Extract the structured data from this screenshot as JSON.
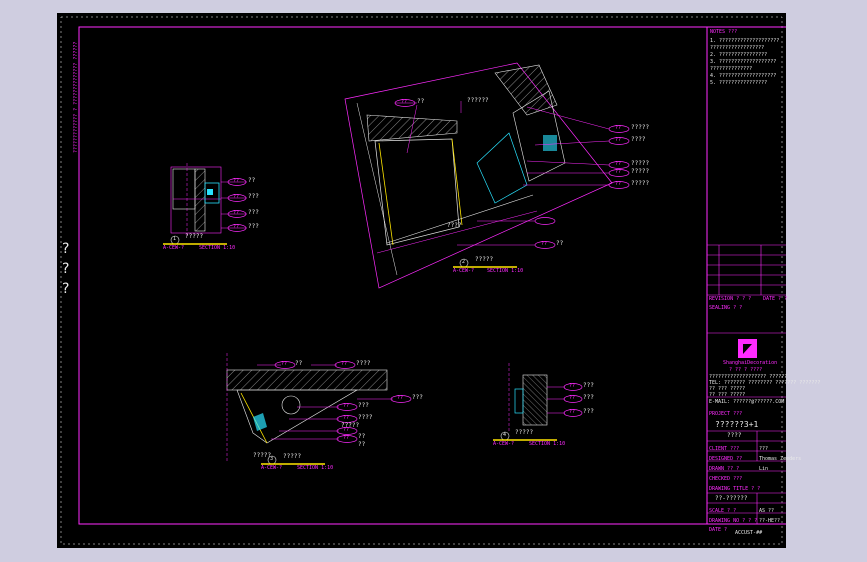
{
  "colors": {
    "background": "#000000",
    "frame": "#ff2bff",
    "text": "#e8e8e8",
    "accent_yellow": "#ffe600",
    "accent_cyan": "#29e3ff",
    "hatch_gray": "#8a8a8a"
  },
  "side_marks": [
    "?",
    "?",
    "?"
  ],
  "vertical_note": "?????????????   ?   ?????????????? ??????",
  "callouts": {
    "d1": [
      {
        "tag": "??",
        "text": "??"
      },
      {
        "tag": "??",
        "text": "???"
      },
      {
        "tag": "??",
        "text": "???"
      },
      {
        "tag": "??",
        "text": "???"
      }
    ],
    "d2": [
      {
        "tag": "??",
        "text": "??"
      },
      {
        "tag": "??",
        "text": "?????"
      },
      {
        "tag": "??",
        "text": "????"
      },
      {
        "tag": "??",
        "text": "?????"
      },
      {
        "tag": "??",
        "text": "?????"
      },
      {
        "tag": "??",
        "text": "?????"
      },
      {
        "tag": "??",
        "text": "??"
      }
    ],
    "d3": [
      {
        "tag": "??",
        "text": "??"
      },
      {
        "tag": "??",
        "text": "????"
      },
      {
        "tag": "??",
        "text": "???"
      },
      {
        "tag": "??",
        "text": "????"
      },
      {
        "tag": "??",
        "text": "??"
      },
      {
        "tag": "??",
        "text": "??"
      },
      {
        "tag": "??",
        "text": "???"
      }
    ],
    "d4": [
      {
        "tag": "??",
        "text": "???"
      },
      {
        "tag": "??",
        "text": "???"
      },
      {
        "tag": "??",
        "text": "???"
      }
    ]
  },
  "labels": {
    "d2_top_note": "??????",
    "d2_mid_note": "????",
    "d3_top_note": "?????",
    "d3_mid_note": "?????"
  },
  "details": [
    {
      "num": "1",
      "tag": "A-CEW-?",
      "title": "?????",
      "section": "SECTION 1:10"
    },
    {
      "num": "2",
      "tag": "A-CEW-?",
      "title": "?????",
      "section": "SECTION 1:10"
    },
    {
      "num": "3",
      "tag": "A-CEW-?",
      "title": "?????",
      "section": "SECTION 1:10"
    },
    {
      "num": "4",
      "tag": "A-CEW-?",
      "title": "?????",
      "section": "SECTION 1:10"
    }
  ],
  "title_block": {
    "notes_header": "NOTES ???",
    "notes": [
      "1. ????????????????????",
      "   ??????????????????",
      "2. ????????????????",
      "3. ???????????????????",
      "   ??????????????",
      "4. ???????????????????",
      "5. ????????????????"
    ],
    "revision_header": "REVISION ? ? ?",
    "revision_right": "DATE ? ?",
    "stamp_header": "SEALING ? ?",
    "company_name": "ShanghaiDecoration",
    "company_sub": "?  ?? ? ????",
    "company_lines": [
      "??????????????????? ??????",
      "TEL: ??????? ???????? ??????? ???????",
      "?? ??? ?????",
      "?? ??? ?????",
      "E-MAIL: ??????@??????.COM"
    ],
    "project_label": "PROJECT ???",
    "project_name": "??????3+1",
    "project_sub": "????",
    "client_label": "CLIENT ???",
    "client_value": "???",
    "designed_label": "DESIGNED ??",
    "designed_value": "Thomas Zeeders",
    "drawn_label": "DRAWN ?? ?",
    "drawn_value": "Lin",
    "checked_label": "CHECKED ???",
    "drawing_title_label": "DRAWING TITLE ? ?",
    "drawing_title": "??-??????",
    "scale_label": "SCALE ? ?",
    "scale_value": "AS ??",
    "drawing_no_label": "DRAWING NO ? ? ?",
    "drawing_no": "??-HE??",
    "date_label": "DATE ?",
    "sheet_code": "ACCUST-##"
  }
}
